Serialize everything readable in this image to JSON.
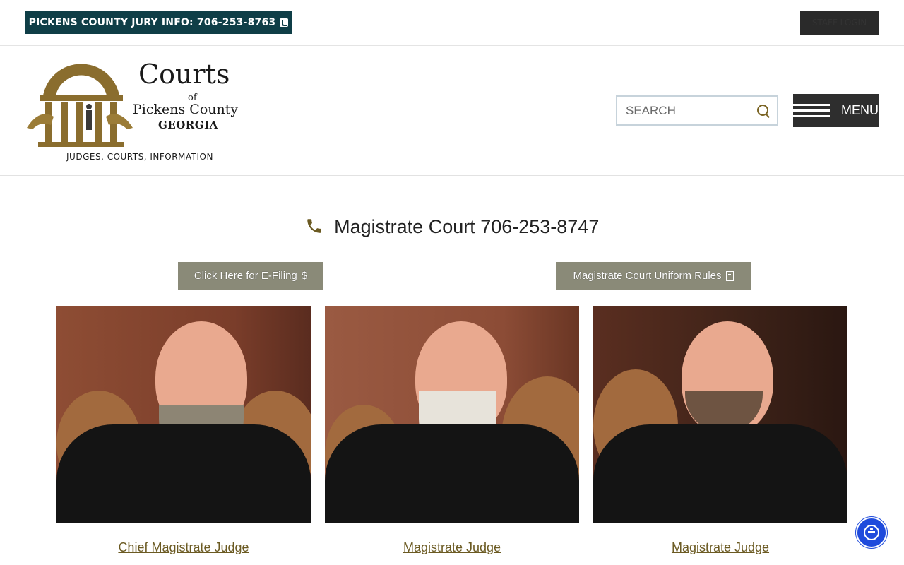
{
  "topbar": {
    "jury_label": "PICKENS COUNTY JURY INFO: 706-253-8763",
    "staff_login_label": "STAFF LOGIN"
  },
  "logo": {
    "title": "Courts",
    "of": "of",
    "county": "Pickens County",
    "state": "GEORGIA",
    "tagline": "JUDGES, COURTS, INFORMATION"
  },
  "search": {
    "placeholder": "SEARCH"
  },
  "menu": {
    "label": "MENU"
  },
  "main": {
    "heading": "Magistrate Court 706-253-8747",
    "efiling_label": "Click Here for E-Filing",
    "efiling_icon": "$",
    "rules_label": "Magistrate Court Uniform Rules"
  },
  "judges": [
    {
      "title": "Chief Magistrate Judge"
    },
    {
      "title": "Magistrate Judge"
    },
    {
      "title": "Magistrate Judge"
    }
  ],
  "colors": {
    "jury_bg": "#0f3e47",
    "brand_gold": "#7b6525",
    "button_gray": "#8a8a78",
    "accessibility_blue": "#1f4bdc"
  }
}
